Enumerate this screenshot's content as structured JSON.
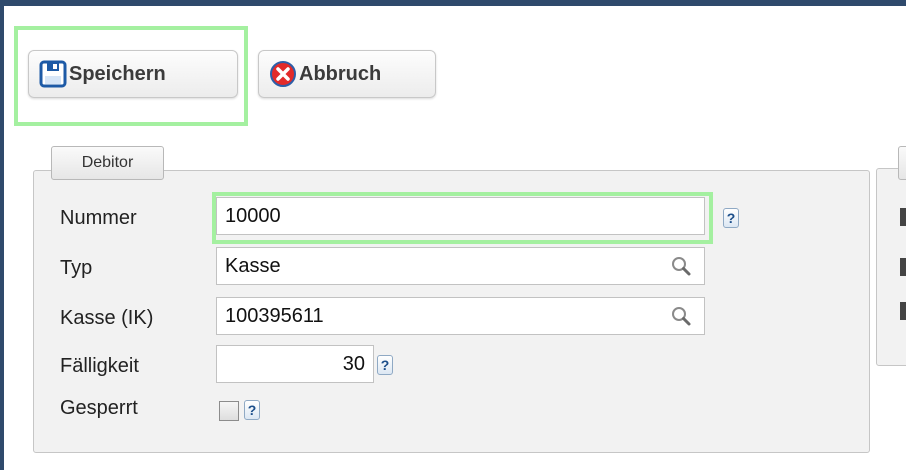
{
  "toolbar": {
    "save_label": "Speichern",
    "cancel_label": "Abbruch"
  },
  "debitor": {
    "title": "Debitor",
    "fields": {
      "nummer": {
        "label": "Nummer",
        "value": "10000"
      },
      "typ": {
        "label": "Typ",
        "value": "Kasse"
      },
      "kasse": {
        "label": "Kasse (IK)",
        "value": "100395611"
      },
      "faelligkeit": {
        "label": "Fälligkeit",
        "value": "30"
      },
      "gesperrt": {
        "label": "Gesperrt",
        "checked": false
      }
    }
  },
  "help_glyph": "?",
  "colors": {
    "window_border": "#2f4a6c",
    "highlight": "#a4f0a0",
    "panel_background": "#f2f2f2"
  },
  "icons": {
    "save": "floppy-disk-icon",
    "cancel": "red-x-icon",
    "lookup": "magnifier-icon",
    "help": "question-mark-icon"
  }
}
